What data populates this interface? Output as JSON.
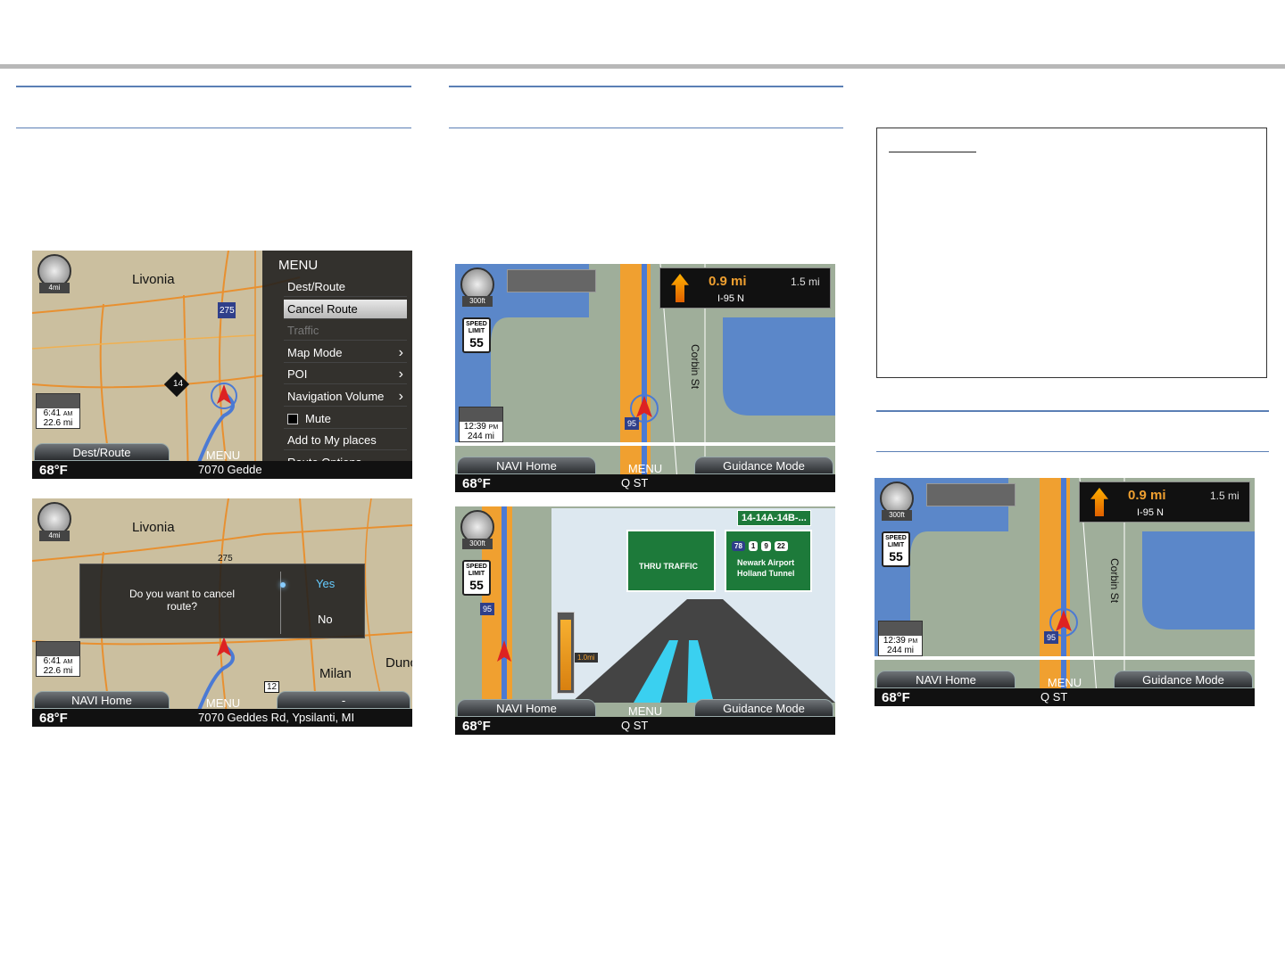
{
  "screen1": {
    "place_label": "Livonia",
    "highway_275": "275",
    "highway_14": "14",
    "scale": "4mi",
    "time": "6:41",
    "ampm": "AM",
    "distance": "22.6 mi",
    "softkey_left": "Dest/Route",
    "softkey_center": "MENU",
    "temperature": "68°F",
    "address": "7070 Gedde",
    "menu": {
      "title": "MENU",
      "items": [
        {
          "label": "Dest/Route",
          "state": "normal"
        },
        {
          "label": "Cancel Route",
          "state": "selected"
        },
        {
          "label": "Traffic",
          "state": "disabled"
        },
        {
          "label": "Map Mode",
          "state": "normal",
          "arrow": true
        },
        {
          "label": "POI",
          "state": "normal",
          "arrow": true
        },
        {
          "label": "Navigation Volume",
          "state": "normal",
          "arrow": true
        },
        {
          "label": "Mute",
          "state": "normal",
          "checkbox": true
        },
        {
          "label": "Add to My places",
          "state": "normal"
        },
        {
          "label": "Route Options",
          "state": "normal"
        }
      ]
    }
  },
  "screen2": {
    "place_label": "Livonia",
    "highway_275": "275",
    "scale": "4mi",
    "dialog_question": "Do you want to cancel route?",
    "yes_label": "Yes",
    "no_label": "No",
    "time": "6:41",
    "ampm": "AM",
    "distance": "22.6 mi",
    "place_milan": "Milan",
    "place_dun": "Dunc",
    "highway_12": "12",
    "softkey_left": "NAVI Home",
    "softkey_center": "MENU",
    "softkey_right": "-",
    "temperature": "68°F",
    "address": "7070 Geddes Rd, Ypsilanti, MI"
  },
  "screen3": {
    "compass_dir": "NE",
    "scale": "300ft",
    "speed_label": "SPEED LIMIT",
    "speed_value": "55",
    "next_distance": "0.9 mi",
    "turn_distance": "1.5 mi",
    "road_name": "I-95 N",
    "street": "Corbin St",
    "shield": "95",
    "time": "12:39",
    "ampm": "PM",
    "distance": "244 mi",
    "softkey_left": "NAVI Home",
    "softkey_center": "MENU",
    "softkey_right": "Guidance Mode",
    "temperature": "68°F",
    "destination": "Q ST"
  },
  "screen4": {
    "compass_dir": "NE",
    "scale": "300ft",
    "speed_label": "SPEED LIMIT",
    "speed_value": "55",
    "shield": "95",
    "exit_sign": "14-14A-14B-...",
    "sign_left": "THRU TRAFFIC",
    "sign_shields": [
      "78",
      "1",
      "9",
      "22"
    ],
    "sign_right_line1": "Newark Airport",
    "sign_right_line2": "Holland Tunnel",
    "bar_label": "1.0mi",
    "softkey_left": "NAVI Home",
    "softkey_center": "MENU",
    "softkey_right": "Guidance Mode",
    "temperature": "68°F",
    "destination": "Q ST"
  },
  "screen5": {
    "compass_dir": "NE",
    "scale": "300ft",
    "speed_label": "SPEED LIMIT",
    "speed_value": "55",
    "next_distance": "0.9 mi",
    "turn_distance": "1.5 mi",
    "road_name": "I-95 N",
    "street": "Corbin St",
    "shield": "95",
    "time": "12:39",
    "ampm": "PM",
    "distance": "244 mi",
    "softkey_left": "NAVI Home",
    "softkey_center": "MENU",
    "softkey_right": "Guidance Mode",
    "temperature": "68°F",
    "destination": "Q ST"
  },
  "colors": {
    "rule": "#5b7fb5",
    "map_land": "#cbbf9f",
    "water": "#5b87c9",
    "route_orange": "#f0a030",
    "accent_orange": "#f0a030"
  }
}
